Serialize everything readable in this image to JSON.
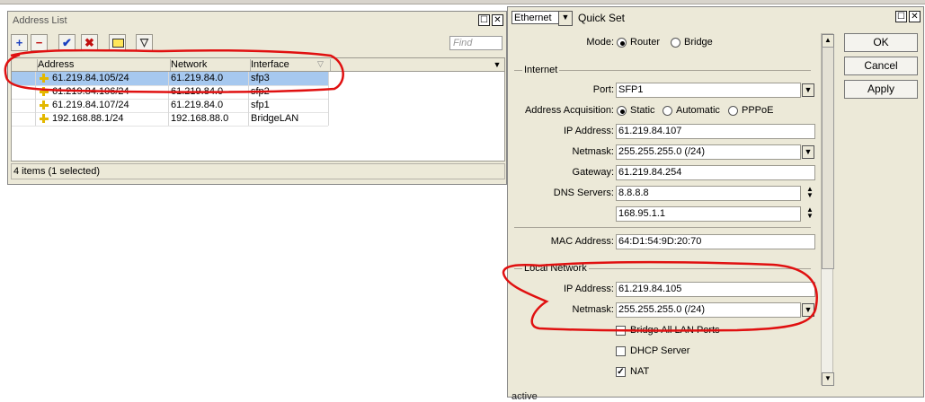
{
  "address_list": {
    "title": "Address List",
    "find_placeholder": "Find",
    "columns": [
      "Address",
      "Network",
      "Interface"
    ],
    "rows": [
      {
        "address": "61.219.84.105/24",
        "network": "61.219.84.0",
        "interface": "sfp3",
        "selected": true
      },
      {
        "address": "61.219.84.106/24",
        "network": "61.219.84.0",
        "interface": "sfp2",
        "selected": false
      },
      {
        "address": "61.219.84.107/24",
        "network": "61.219.84.0",
        "interface": "sfp1",
        "selected": false
      },
      {
        "address": "192.168.88.1/24",
        "network": "192.168.88.0",
        "interface": "BridgeLAN",
        "selected": false
      }
    ],
    "status": "4 items (1 selected)"
  },
  "quick_set": {
    "mode_select": "Ethernet",
    "title": "Quick Set",
    "mode_label": "Mode:",
    "mode_options": [
      "Router",
      "Bridge"
    ],
    "internet": {
      "section": "Internet",
      "port_label": "Port:",
      "port_value": "SFP1",
      "acq_label": "Address Acquisition:",
      "acq_options": [
        "Static",
        "Automatic",
        "PPPoE"
      ],
      "ip_label": "IP Address:",
      "ip_value": "61.219.84.107",
      "netmask_label": "Netmask:",
      "netmask_value": "255.255.255.0 (/24)",
      "gateway_label": "Gateway:",
      "gateway_value": "61.219.84.254",
      "dns_label": "DNS Servers:",
      "dns1": "8.8.8.8",
      "dns2": "168.95.1.1",
      "mac_label": "MAC Address:",
      "mac_value": "64:D1:54:9D:20:70"
    },
    "local": {
      "section": "Local Network",
      "ip_label": "IP Address:",
      "ip_value": "61.219.84.105",
      "netmask_label": "Netmask:",
      "netmask_value": "255.255.255.0 (/24)",
      "bridge_label": "Bridge All LAN Ports",
      "dhcp_label": "DHCP Server",
      "nat_label": "NAT",
      "nat_checked": true
    },
    "buttons": {
      "ok": "OK",
      "cancel": "Cancel",
      "apply": "Apply"
    },
    "status_text": "active"
  },
  "colors": {
    "annotation": "#e01010",
    "selection": "#a6c8ef"
  }
}
